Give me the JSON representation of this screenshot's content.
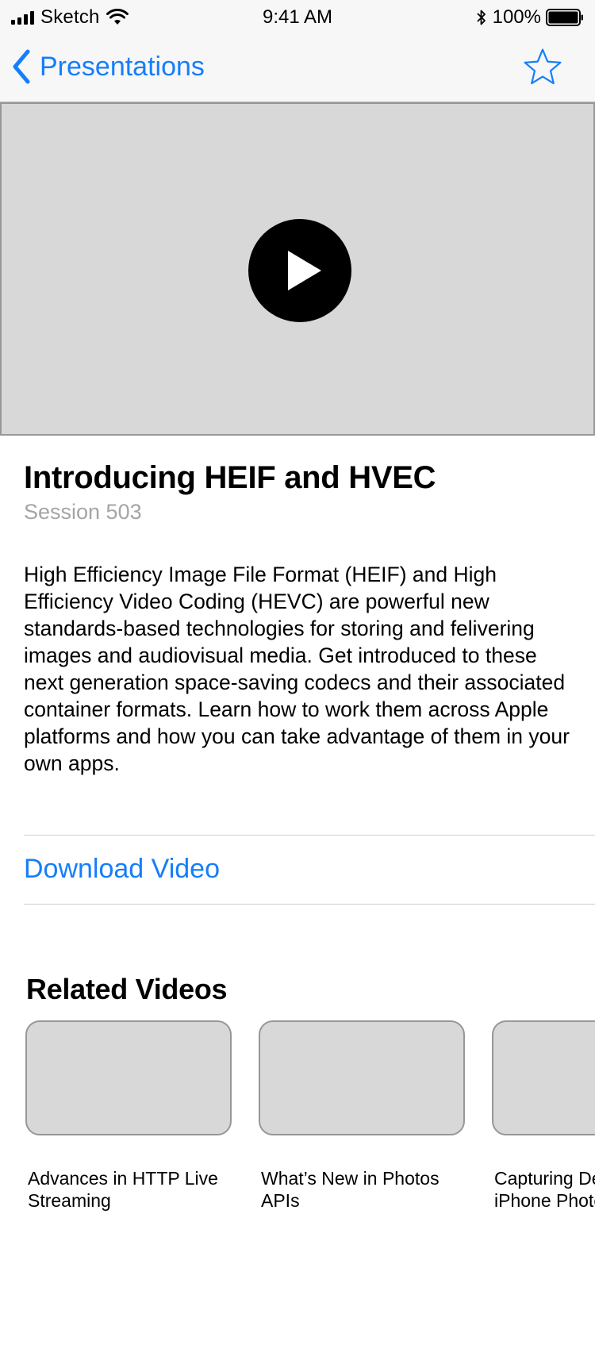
{
  "status_bar": {
    "carrier": "Sketch",
    "time": "9:41 AM",
    "battery": "100%"
  },
  "nav": {
    "back_label": "Presentations",
    "back_icon": "chevron-left-icon",
    "favorite_icon": "star-outline-icon"
  },
  "video": {
    "play_icon": "play-icon"
  },
  "session": {
    "title": "Introducing HEIF and HVEC",
    "subtitle": "Session 503",
    "description_lines": [
      "High Efficiency Image File Format (HEIF) and High",
      "Efficiency Video Coding (HEVC) are powerful new",
      "standards-based technologies for storing and felivering",
      "images and audiovisual media. Get introduced to these",
      "next generation space-saving codecs and their associated",
      "container formats. Learn how to work them across Apple",
      "platforms and how you can take advantage of them in your",
      "own apps."
    ]
  },
  "download_label": "Download Video",
  "related": {
    "heading": "Related Videos",
    "items": [
      {
        "title_line1": "Advances in HTTP Live",
        "title_line2": "Streaming"
      },
      {
        "title_line1": "What’s New in Photos",
        "title_line2": "APIs"
      },
      {
        "title_line1": "Capturing De",
        "title_line2": "iPhone Photo"
      }
    ]
  },
  "colors": {
    "accent": "#157efb",
    "bar_background": "#f7f7f7",
    "placeholder_fill": "#d8d8d8",
    "placeholder_border": "#979797",
    "secondary_text": "#a5a5a5"
  }
}
